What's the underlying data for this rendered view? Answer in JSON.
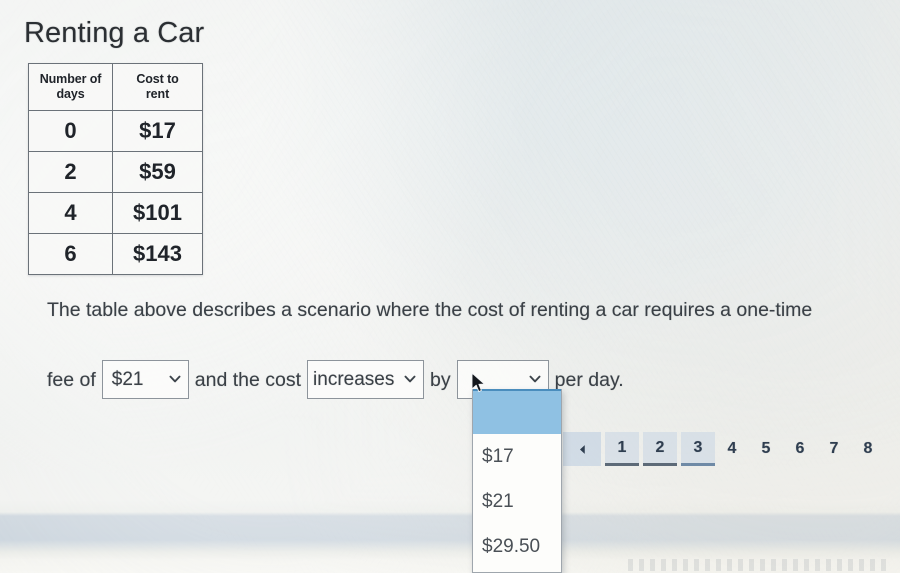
{
  "page": {
    "title": "Renting a Car"
  },
  "table": {
    "name": "cost-table",
    "headers": [
      "Number of days",
      "Cost to rent"
    ],
    "header_lines": [
      [
        "Number of",
        "days"
      ],
      [
        "Cost to",
        "rent"
      ]
    ],
    "rows": [
      {
        "days": "0",
        "cost": "$17"
      },
      {
        "days": "2",
        "cost": "$59"
      },
      {
        "days": "4",
        "cost": "$101"
      },
      {
        "days": "6",
        "cost": "$143"
      }
    ]
  },
  "prompt": {
    "line1": "The table above describes a scenario where the cost of renting a car requires a one-time",
    "fee_label": "fee of",
    "and_label": "and the cost",
    "by_label": "by",
    "tail_label": "per day."
  },
  "selects": {
    "fee": {
      "value": "$21",
      "placeholder": "",
      "caret": "chevron-down-icon"
    },
    "trend": {
      "value": "increases",
      "placeholder": "",
      "caret": "chevron-down-icon"
    },
    "rate": {
      "value": "",
      "placeholder": "",
      "caret": "chevron-down-icon",
      "open": true,
      "options": [
        "",
        "$17",
        "$21",
        "$29.50"
      ],
      "selected_index": 0
    }
  },
  "pagination": {
    "prev_icon": "triangle-left-icon",
    "pages": [
      "1",
      "2",
      "3",
      "4",
      "5",
      "6",
      "7",
      "8"
    ],
    "boxed_pages": [
      "1",
      "2",
      "3"
    ],
    "current": "3"
  },
  "colors": {
    "page_background": "#eff1ef",
    "band": "#c9d3dc",
    "table_border": "#6b7279",
    "text": "#3a4046",
    "title": "#2b2f33",
    "select_border": "#8d949b",
    "dropdown_highlight": "#8fc1e3",
    "dropdown_highlight_edge": "#4a8dbd",
    "pagination_box": "#c8d6e4",
    "pagination_text": "#2f3e50",
    "pagination_underline": "#5d6a78"
  }
}
